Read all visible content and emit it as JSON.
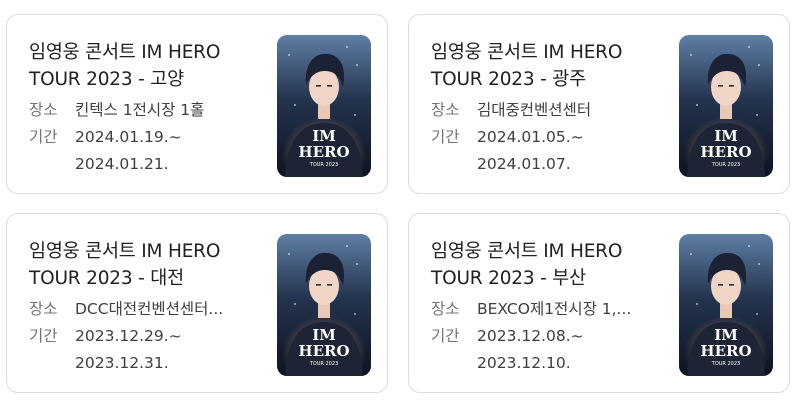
{
  "results": [
    {
      "title_line1": "임영웅 콘서트 IM HERO",
      "title_line2": "TOUR 2023 - 고양",
      "place_label": "장소",
      "place": "킨텍스 1전시장 1홀",
      "period_label": "기간",
      "period_start": "2024.01.19.~",
      "period_end": "2024.01.21."
    },
    {
      "title_line1": "임영웅 콘서트 IM HERO",
      "title_line2": "TOUR 2023 - 광주",
      "place_label": "장소",
      "place": "김대중컨벤션센터",
      "period_label": "기간",
      "period_start": "2024.01.05.~",
      "period_end": "2024.01.07."
    },
    {
      "title_line1": "임영웅 콘서트 IM HERO",
      "title_line2": "TOUR 2023 - 대전",
      "place_label": "장소",
      "place": "DCC대전컨벤션센터...",
      "period_label": "기간",
      "period_start": "2023.12.29.~",
      "period_end": "2023.12.31."
    },
    {
      "title_line1": "임영웅 콘서트 IM HERO",
      "title_line2": "TOUR 2023 - 부산",
      "place_label": "장소",
      "place": "BEXCO제1전시장 1,...",
      "period_label": "기간",
      "period_start": "2023.12.08.~",
      "period_end": "2023.12.10."
    }
  ],
  "poster": {
    "logo_line1": "IM",
    "logo_line2": "HERO",
    "logo_line3": "TOUR 2023"
  }
}
